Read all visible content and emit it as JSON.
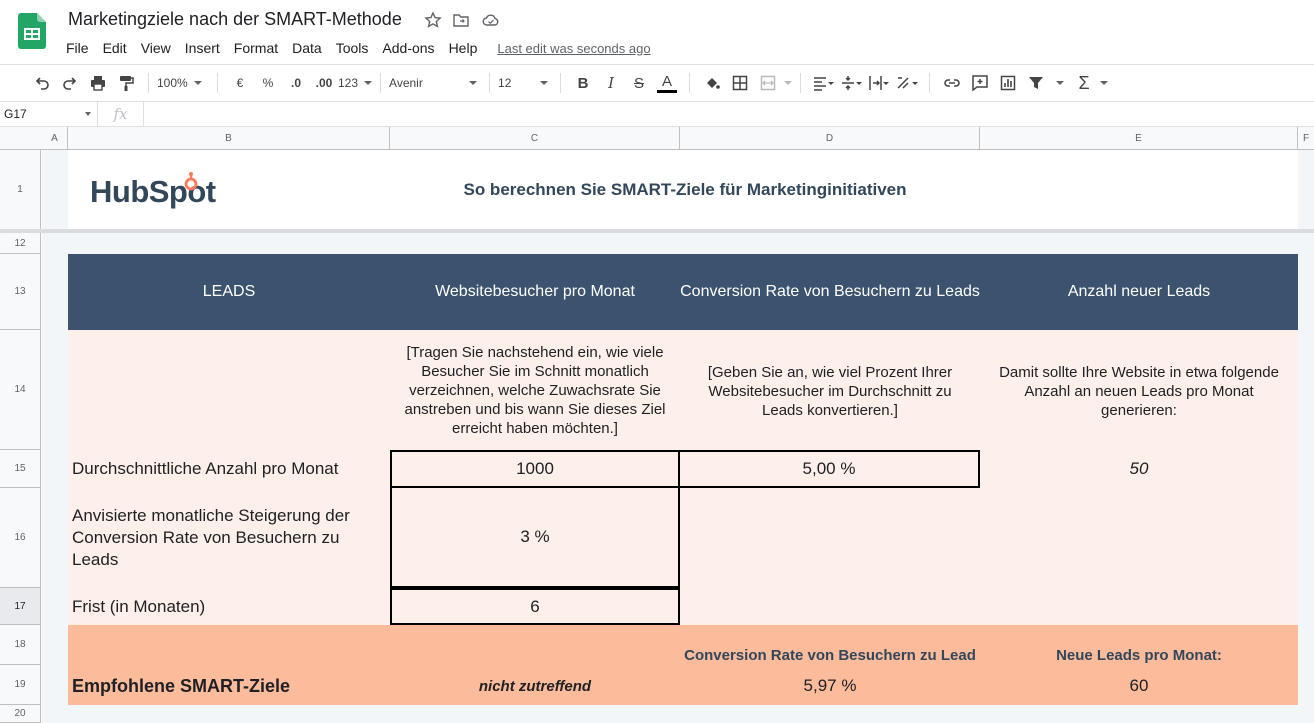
{
  "app": {
    "doc_title": "Marketingziele nach der SMART-Methode",
    "menu": [
      "File",
      "Edit",
      "View",
      "Insert",
      "Format",
      "Data",
      "Tools",
      "Add-ons",
      "Help"
    ],
    "last_edit": "Last edit was seconds ago"
  },
  "toolbar": {
    "zoom": "100%",
    "currency": "€",
    "percent": "%",
    "dec_less": ".0",
    "dec_more": ".00",
    "format_more": "123",
    "font": "Avenir",
    "font_size": "12",
    "bold": "B",
    "italic": "I",
    "strike": "S",
    "text_color": "A"
  },
  "formula_bar": {
    "cell_ref": "G17",
    "fx": "fx",
    "value": ""
  },
  "columns": [
    "A",
    "B",
    "C",
    "D",
    "E",
    "F"
  ],
  "rows": [
    "1",
    "12",
    "13",
    "14",
    "15",
    "16",
    "17",
    "18",
    "19",
    "20"
  ],
  "sheet": {
    "logo_text": "HubSpot",
    "title": "So berechnen Sie SMART-Ziele für Marketinginitiativen",
    "header": {
      "b": "LEADS",
      "c": "Websitebesucher pro Monat",
      "d": "Conversion Rate von Besuchern zu Leads",
      "e": "Anzahl neuer Leads"
    },
    "instructions": {
      "c": "[Tragen Sie nachstehend ein, wie viele Besucher Sie im Schnitt monatlich verzeichnen, welche Zuwachsrate Sie anstreben und bis wann Sie dieses Ziel erreicht haben möchten.]",
      "d": "[Geben Sie an, wie viel Prozent Ihrer Websitebesucher im Durchschnitt zu Leads konvertieren.]",
      "e": "Damit sollte Ihre Website in etwa folgende Anzahl an neuen Leads pro Monat generieren:"
    },
    "row15": {
      "label": "Durchschnittliche Anzahl pro Monat",
      "visitors": "1000",
      "conversion": "5,00 %",
      "leads": "50"
    },
    "row16": {
      "label": "Anvisierte monatliche Steigerung der Conversion Rate von Besuchern zu Leads",
      "value": "3 %"
    },
    "row17": {
      "label": "Frist (in Monaten)",
      "value": "6"
    },
    "result": {
      "d_header": "Conversion Rate von Besuchern zu Lead",
      "e_header": "Neue Leads pro Monat:",
      "label": "Empfohlene SMART-Ziele",
      "c_value": "nicht zutreffend",
      "d_value": "5,97 %",
      "e_value": "60"
    }
  },
  "colors": {
    "header_bg": "#3b536e",
    "input_bg": "#fdf0eb",
    "result_bg": "#fcbc9c",
    "logo_accent": "#ff7a59"
  }
}
